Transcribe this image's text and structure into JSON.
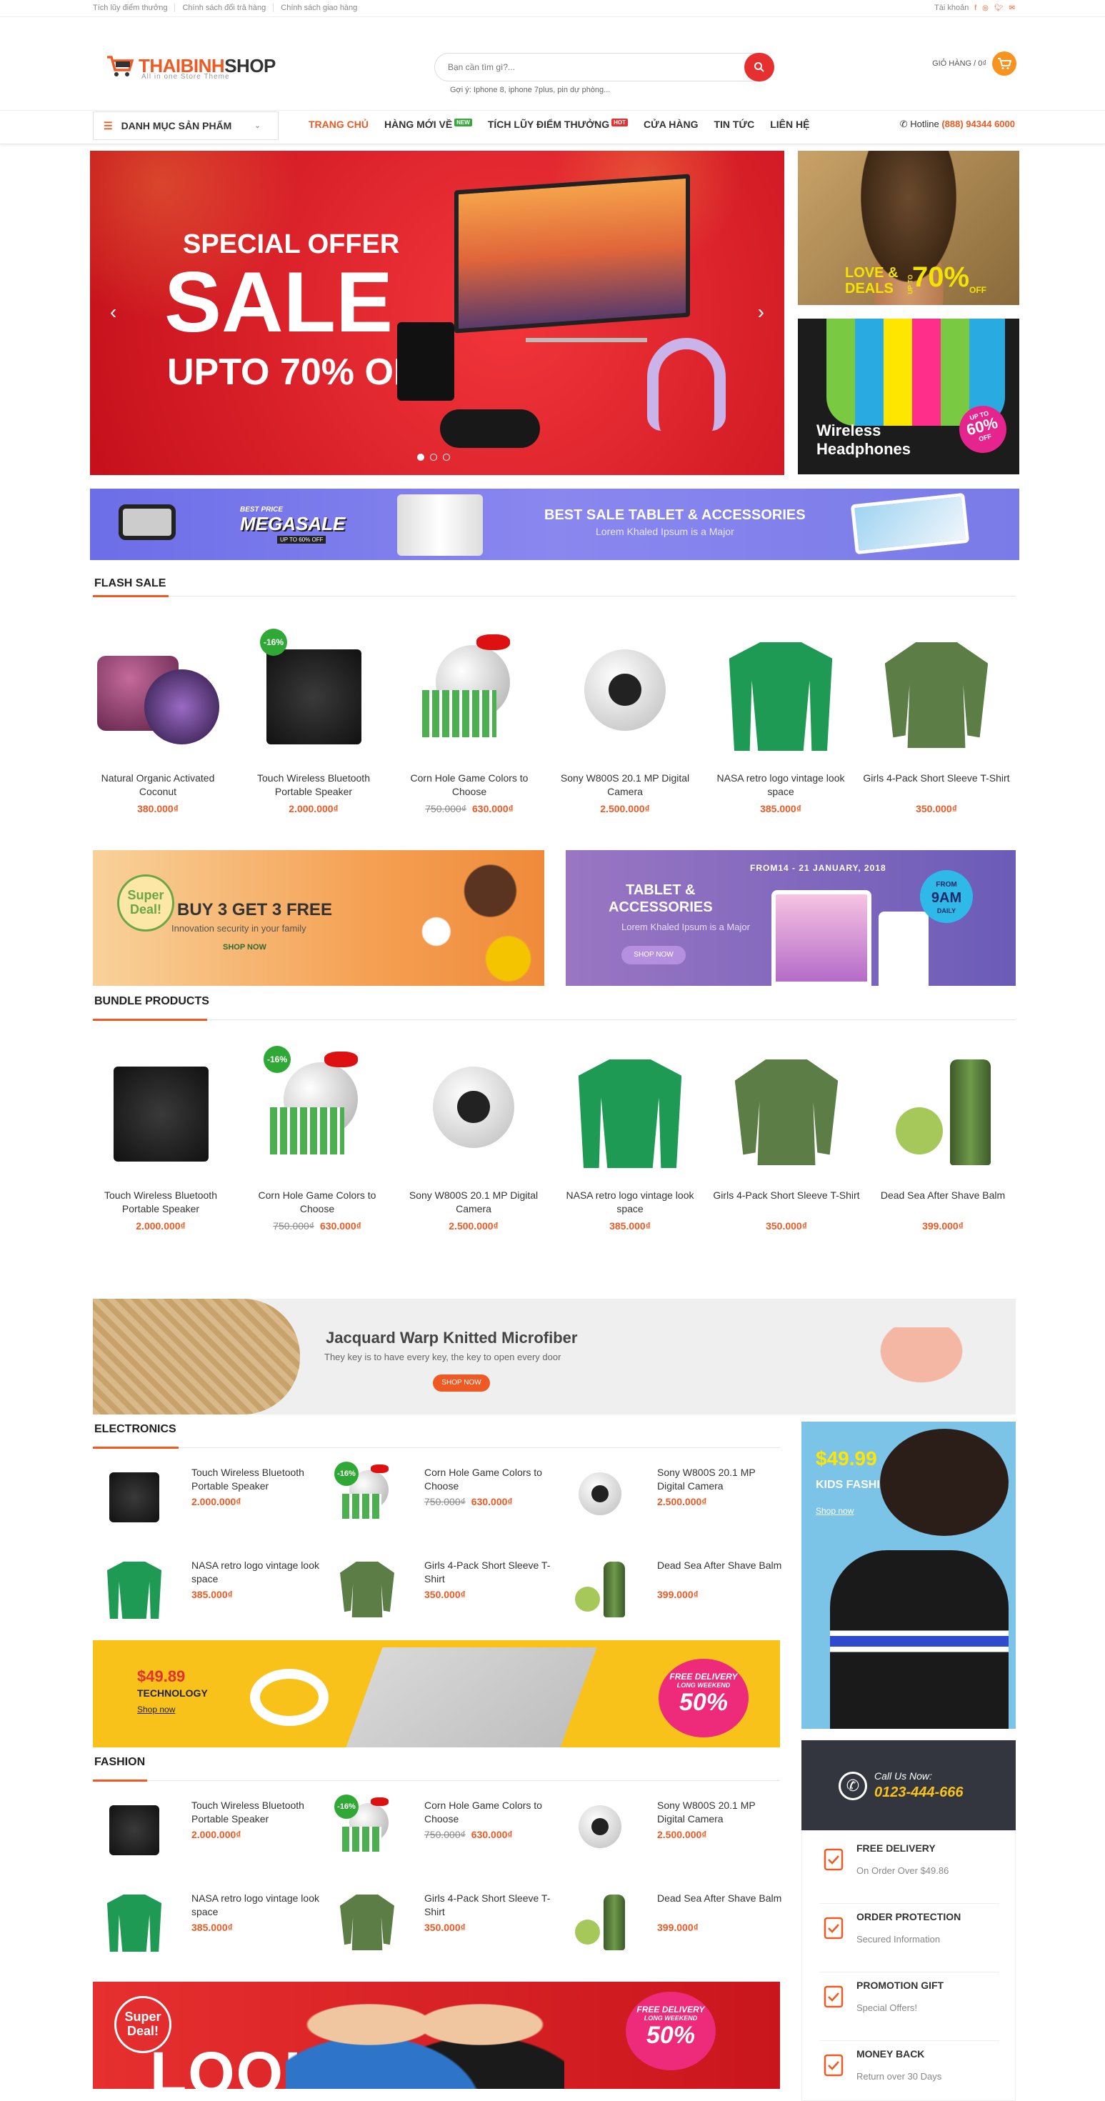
{
  "topbar": {
    "links": [
      "Tích lũy điểm thưởng",
      "Chính sách đổi trả hàng",
      "Chính sách giao hàng"
    ],
    "account": "Tài khoản"
  },
  "header": {
    "logo_part1": "THAIBINH",
    "logo_part2": "SHOP",
    "logo_tagline": "All in one Store Theme",
    "search_placeholder": "Bạn cần tìm gì?...",
    "search_suggest": "Gợi ý: Iphone 8, iphone 7plus, pin dự phòng...",
    "cart_label": "GIỎ HÀNG / 0₫"
  },
  "nav": {
    "category_button": "DANH MỤC SẢN PHẨM",
    "items": [
      "TRANG CHỦ",
      "HÀNG MỚI VỀ",
      "TÍCH LŨY ĐIỂM THƯỞNG",
      "CỬA HÀNG",
      "TIN TỨC",
      "LIÊN HỆ"
    ],
    "new_badge": "NEW",
    "hot_badge": "HOT",
    "hotline_label": "Hotline",
    "hotline_number": "(888) 94344 6000"
  },
  "slider": {
    "line1": "SPECIAL OFFER",
    "line2": "SALE",
    "line3": "UPTO 70% OFF"
  },
  "side_banners": {
    "top_line1": "LOVE &",
    "top_line2": "DEALS",
    "top_up": "UP TO",
    "top_pct": "70%",
    "top_off": "OFF",
    "bottom_line1": "Wireless",
    "bottom_line2": "Headphones",
    "bottom_badge_top": "UP TO",
    "bottom_badge_pct": "60%",
    "bottom_badge_off": "OFF"
  },
  "wide_banner": {
    "best_price": "BEST PRICE",
    "megasale": "MEGASALE",
    "up_to": "UP TO 60% OFF",
    "title": "BEST SALE TABLET &  ACCESSORIES",
    "subtitle": "Lorem Khaled Ipsum is a Major"
  },
  "flash_sale": {
    "title": "FLASH SALE",
    "products": [
      {
        "name": "Natural Organic Activated Coconut",
        "price": "380.000₫",
        "old": "",
        "sale": ""
      },
      {
        "name": "Touch Wireless Bluetooth Portable Speaker",
        "price": "2.000.000₫",
        "old": "",
        "sale": "-16%"
      },
      {
        "name": "Corn Hole Game Colors to Choose",
        "price": "630.000₫",
        "old": "750.000₫",
        "sale": ""
      },
      {
        "name": "Sony W800S 20.1 MP Digital Camera",
        "price": "2.500.000₫",
        "old": "",
        "sale": ""
      },
      {
        "name": "NASA retro logo vintage look space",
        "price": "385.000₫",
        "old": "",
        "sale": ""
      },
      {
        "name": "Girls 4-Pack Short Sleeve T-Shirt",
        "price": "350.000₫",
        "old": "",
        "sale": ""
      }
    ]
  },
  "promo_left": {
    "badge1": "Super",
    "badge2": "Deal!",
    "title": "BUY 3 GET 3 FREE",
    "sub": "Innovation security in your  family",
    "cta": "SHOP NOW"
  },
  "promo_right": {
    "date": "FROM14 - 21 JANUARY, 2018",
    "title1": "TABLET &",
    "title2": "ACCESSORIES",
    "sub": "Lorem Khaled Ipsum is a Major",
    "cta": "SHOP NOW",
    "badge_from": "FROM",
    "badge_time": "9AM",
    "badge_daily": "DAILY"
  },
  "bundle": {
    "title": "BUNDLE PRODUCTS",
    "products": [
      {
        "name": "Touch Wireless Bluetooth Portable Speaker",
        "price": "2.000.000₫",
        "old": "",
        "sale": ""
      },
      {
        "name": "Corn Hole Game Colors to Choose",
        "price": "630.000₫",
        "old": "750.000₫",
        "sale": "-16%"
      },
      {
        "name": "Sony W800S 20.1 MP Digital Camera",
        "price": "2.500.000₫",
        "old": "",
        "sale": ""
      },
      {
        "name": "NASA retro logo vintage look space",
        "price": "385.000₫",
        "old": "",
        "sale": ""
      },
      {
        "name": "Girls 4-Pack Short Sleeve T-Shirt",
        "price": "350.000₫",
        "old": "",
        "sale": ""
      },
      {
        "name": "Dead Sea After Shave Balm",
        "price": "399.000₫",
        "old": "",
        "sale": ""
      }
    ]
  },
  "jacquard": {
    "title": "Jacquard Warp Knitted Microfiber",
    "sub": "They key is to have every key, the key to open every door",
    "cta": "SHOP NOW"
  },
  "electronics": {
    "title": "ELECTRONICS",
    "products": [
      {
        "name": "Touch Wireless Bluetooth Portable Speaker",
        "price": "2.000.000₫",
        "old": "",
        "sale": ""
      },
      {
        "name": "Corn Hole Game Colors to Choose",
        "price": "630.000₫",
        "old": "750.000₫",
        "sale": "-16%"
      },
      {
        "name": "Sony W800S 20.1 MP Digital Camera",
        "price": "2.500.000₫",
        "old": "",
        "sale": ""
      },
      {
        "name": "NASA retro logo vintage look space",
        "price": "385.000₫",
        "old": "",
        "sale": ""
      },
      {
        "name": "Girls 4-Pack Short Sleeve T-Shirt",
        "price": "350.000₫",
        "old": "",
        "sale": ""
      },
      {
        "name": "Dead Sea After Shave Balm",
        "price": "399.000₫",
        "old": "",
        "sale": ""
      }
    ]
  },
  "tech_banner": {
    "price": "$49.89",
    "label": "TECHNOLOGY",
    "cta": "Shop now",
    "badge1": "FREE DELIVERY",
    "badge2": "LONG WEEKEND",
    "badge3": "50%"
  },
  "kids_banner": {
    "price": "$49.99",
    "label": "KIDS FASHION",
    "cta": "Shop now"
  },
  "fashion": {
    "title": "FASHION",
    "products": [
      {
        "name": "Touch Wireless Bluetooth Portable Speaker",
        "price": "2.000.000₫",
        "old": "",
        "sale": ""
      },
      {
        "name": "Corn Hole Game Colors to Choose",
        "price": "630.000₫",
        "old": "750.000₫",
        "sale": "-16%"
      },
      {
        "name": "Sony W800S 20.1 MP Digital Camera",
        "price": "2.500.000₫",
        "old": "",
        "sale": ""
      },
      {
        "name": "NASA retro logo vintage look space",
        "price": "385.000₫",
        "old": "",
        "sale": ""
      },
      {
        "name": "Girls 4-Pack Short Sleeve T-Shirt",
        "price": "350.000₫",
        "old": "",
        "sale": ""
      },
      {
        "name": "Dead Sea After Shave Balm",
        "price": "399.000₫",
        "old": "",
        "sale": ""
      }
    ]
  },
  "call_box": {
    "label": "Call Us Now:",
    "number": "0123-444-666"
  },
  "features": [
    {
      "title": "FREE DELIVERY",
      "sub": "On Order Over $49.86",
      "icon": "clipboard-icon"
    },
    {
      "title": "ORDER PROTECTION",
      "sub": "Secured Information",
      "icon": "shield-icon"
    },
    {
      "title": "PROMOTION GIFT",
      "sub": "Special Offers!",
      "icon": "gift-icon"
    },
    {
      "title": "MONEY BACK",
      "sub": "Return over 30 Days",
      "icon": "money-icon"
    }
  ],
  "looks_banner": {
    "badge1": "Super",
    "badge2": "Deal!",
    "word": "LOOKS",
    "r1": "FREE DELIVERY",
    "r2": "LONG WEEKEND",
    "r3": "50%"
  },
  "colors": {
    "accent": "#ef5a24",
    "sale_green": "#30a835",
    "hot_red": "#e62f2f"
  }
}
